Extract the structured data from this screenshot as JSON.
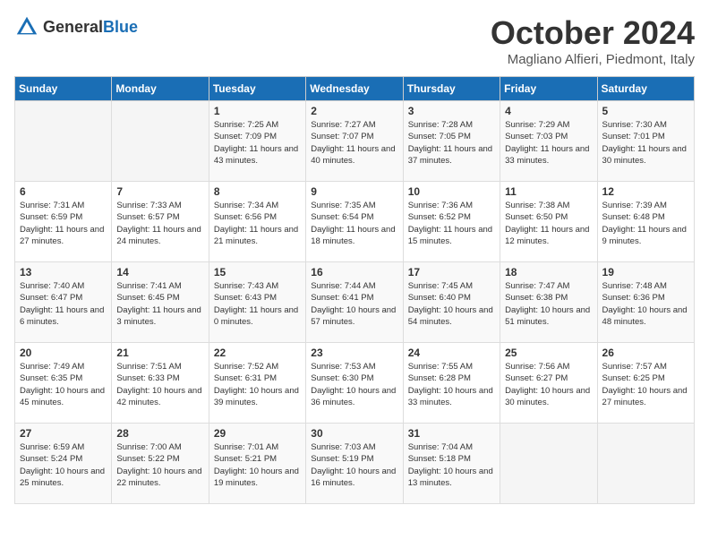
{
  "header": {
    "logo_general": "General",
    "logo_blue": "Blue",
    "month": "October 2024",
    "location": "Magliano Alfieri, Piedmont, Italy"
  },
  "days_of_week": [
    "Sunday",
    "Monday",
    "Tuesday",
    "Wednesday",
    "Thursday",
    "Friday",
    "Saturday"
  ],
  "weeks": [
    [
      {
        "day": "",
        "info": ""
      },
      {
        "day": "",
        "info": ""
      },
      {
        "day": "1",
        "info": "Sunrise: 7:25 AM\nSunset: 7:09 PM\nDaylight: 11 hours and 43 minutes."
      },
      {
        "day": "2",
        "info": "Sunrise: 7:27 AM\nSunset: 7:07 PM\nDaylight: 11 hours and 40 minutes."
      },
      {
        "day": "3",
        "info": "Sunrise: 7:28 AM\nSunset: 7:05 PM\nDaylight: 11 hours and 37 minutes."
      },
      {
        "day": "4",
        "info": "Sunrise: 7:29 AM\nSunset: 7:03 PM\nDaylight: 11 hours and 33 minutes."
      },
      {
        "day": "5",
        "info": "Sunrise: 7:30 AM\nSunset: 7:01 PM\nDaylight: 11 hours and 30 minutes."
      }
    ],
    [
      {
        "day": "6",
        "info": "Sunrise: 7:31 AM\nSunset: 6:59 PM\nDaylight: 11 hours and 27 minutes."
      },
      {
        "day": "7",
        "info": "Sunrise: 7:33 AM\nSunset: 6:57 PM\nDaylight: 11 hours and 24 minutes."
      },
      {
        "day": "8",
        "info": "Sunrise: 7:34 AM\nSunset: 6:56 PM\nDaylight: 11 hours and 21 minutes."
      },
      {
        "day": "9",
        "info": "Sunrise: 7:35 AM\nSunset: 6:54 PM\nDaylight: 11 hours and 18 minutes."
      },
      {
        "day": "10",
        "info": "Sunrise: 7:36 AM\nSunset: 6:52 PM\nDaylight: 11 hours and 15 minutes."
      },
      {
        "day": "11",
        "info": "Sunrise: 7:38 AM\nSunset: 6:50 PM\nDaylight: 11 hours and 12 minutes."
      },
      {
        "day": "12",
        "info": "Sunrise: 7:39 AM\nSunset: 6:48 PM\nDaylight: 11 hours and 9 minutes."
      }
    ],
    [
      {
        "day": "13",
        "info": "Sunrise: 7:40 AM\nSunset: 6:47 PM\nDaylight: 11 hours and 6 minutes."
      },
      {
        "day": "14",
        "info": "Sunrise: 7:41 AM\nSunset: 6:45 PM\nDaylight: 11 hours and 3 minutes."
      },
      {
        "day": "15",
        "info": "Sunrise: 7:43 AM\nSunset: 6:43 PM\nDaylight: 11 hours and 0 minutes."
      },
      {
        "day": "16",
        "info": "Sunrise: 7:44 AM\nSunset: 6:41 PM\nDaylight: 10 hours and 57 minutes."
      },
      {
        "day": "17",
        "info": "Sunrise: 7:45 AM\nSunset: 6:40 PM\nDaylight: 10 hours and 54 minutes."
      },
      {
        "day": "18",
        "info": "Sunrise: 7:47 AM\nSunset: 6:38 PM\nDaylight: 10 hours and 51 minutes."
      },
      {
        "day": "19",
        "info": "Sunrise: 7:48 AM\nSunset: 6:36 PM\nDaylight: 10 hours and 48 minutes."
      }
    ],
    [
      {
        "day": "20",
        "info": "Sunrise: 7:49 AM\nSunset: 6:35 PM\nDaylight: 10 hours and 45 minutes."
      },
      {
        "day": "21",
        "info": "Sunrise: 7:51 AM\nSunset: 6:33 PM\nDaylight: 10 hours and 42 minutes."
      },
      {
        "day": "22",
        "info": "Sunrise: 7:52 AM\nSunset: 6:31 PM\nDaylight: 10 hours and 39 minutes."
      },
      {
        "day": "23",
        "info": "Sunrise: 7:53 AM\nSunset: 6:30 PM\nDaylight: 10 hours and 36 minutes."
      },
      {
        "day": "24",
        "info": "Sunrise: 7:55 AM\nSunset: 6:28 PM\nDaylight: 10 hours and 33 minutes."
      },
      {
        "day": "25",
        "info": "Sunrise: 7:56 AM\nSunset: 6:27 PM\nDaylight: 10 hours and 30 minutes."
      },
      {
        "day": "26",
        "info": "Sunrise: 7:57 AM\nSunset: 6:25 PM\nDaylight: 10 hours and 27 minutes."
      }
    ],
    [
      {
        "day": "27",
        "info": "Sunrise: 6:59 AM\nSunset: 5:24 PM\nDaylight: 10 hours and 25 minutes."
      },
      {
        "day": "28",
        "info": "Sunrise: 7:00 AM\nSunset: 5:22 PM\nDaylight: 10 hours and 22 minutes."
      },
      {
        "day": "29",
        "info": "Sunrise: 7:01 AM\nSunset: 5:21 PM\nDaylight: 10 hours and 19 minutes."
      },
      {
        "day": "30",
        "info": "Sunrise: 7:03 AM\nSunset: 5:19 PM\nDaylight: 10 hours and 16 minutes."
      },
      {
        "day": "31",
        "info": "Sunrise: 7:04 AM\nSunset: 5:18 PM\nDaylight: 10 hours and 13 minutes."
      },
      {
        "day": "",
        "info": ""
      },
      {
        "day": "",
        "info": ""
      }
    ]
  ]
}
